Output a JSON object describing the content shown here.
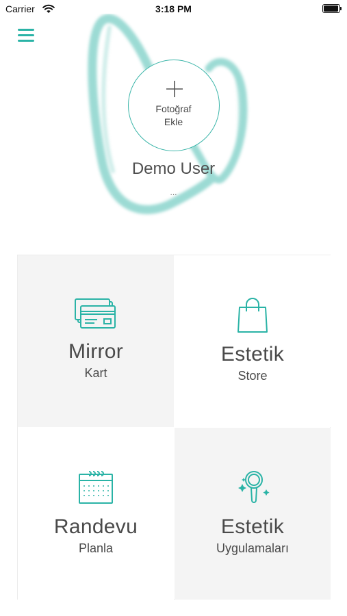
{
  "status_bar": {
    "carrier": "Carrier",
    "time": "3:18 PM"
  },
  "profile": {
    "add_photo_line1": "Fotoğraf",
    "add_photo_line2": "Ekle",
    "name": "Demo User",
    "subtitle": "..."
  },
  "tiles": [
    {
      "title": "Mirror",
      "subtitle": "Kart",
      "icon": "cards-icon"
    },
    {
      "title": "Estetik",
      "subtitle": "Store",
      "icon": "shopping-bag-icon"
    },
    {
      "title": "Randevu",
      "subtitle": "Planla",
      "icon": "calendar-icon"
    },
    {
      "title": "Estetik",
      "subtitle": "Uygulamaları",
      "icon": "hand-mirror-icon"
    }
  ],
  "colors": {
    "accent": "#2ab3a6",
    "tile_gray": "#f4f4f4"
  }
}
